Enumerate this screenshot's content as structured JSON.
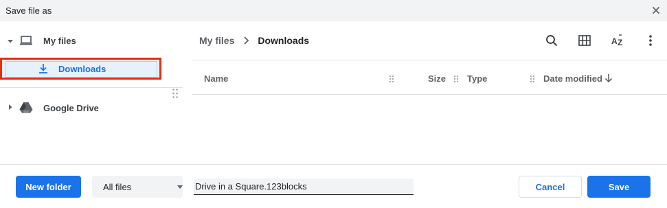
{
  "window": {
    "title": "Save file as",
    "close_icon": "close-icon"
  },
  "sidebar": {
    "my_files": {
      "label": "My files",
      "icon": "laptop-icon",
      "expanded": true
    },
    "downloads": {
      "label": "Downloads",
      "icon": "download-icon",
      "selected": true
    },
    "google_drive": {
      "label": "Google Drive",
      "icon": "google-drive-icon",
      "expanded": false
    }
  },
  "breadcrumb": {
    "items": [
      "My files",
      "Downloads"
    ]
  },
  "toolbar": {
    "icons": [
      "search-icon",
      "grid-view-icon",
      "sort-az-icon",
      "more-vert-icon"
    ]
  },
  "columns": {
    "name": "Name",
    "size": "Size",
    "type": "Type",
    "date_modified": "Date modified",
    "sort_direction": "descending"
  },
  "footer": {
    "new_folder_label": "New folder",
    "file_type_selected": "All files",
    "filename_value": "Drive in a Square.123blocks",
    "cancel_label": "Cancel",
    "save_label": "Save"
  },
  "colors": {
    "accent": "#1a73e8",
    "highlight_border": "#ea2c0f",
    "selected_bg": "#e8f0fe"
  }
}
